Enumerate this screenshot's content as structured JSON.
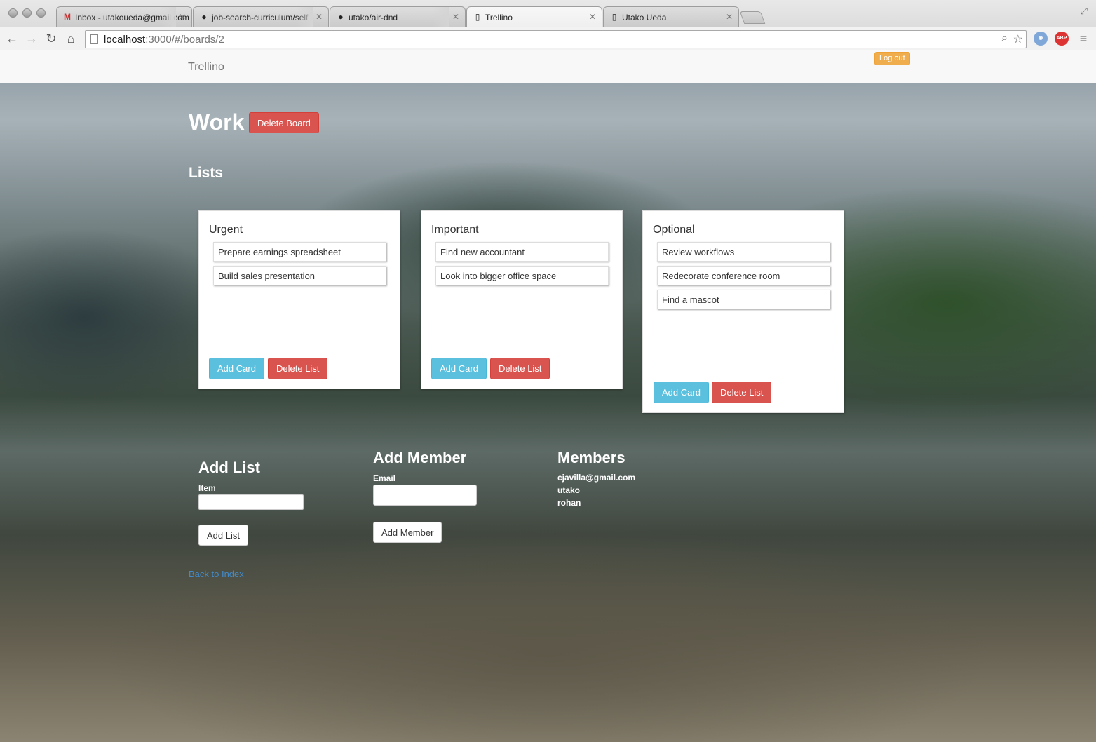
{
  "browser": {
    "tabs": [
      {
        "title": "Inbox - utakoueda@gmail.com",
        "icon": "gmail-icon"
      },
      {
        "title": "job-search-curriculum/self",
        "icon": "github-icon"
      },
      {
        "title": "utako/air-dnd",
        "icon": "github-icon"
      },
      {
        "title": "Trellino",
        "icon": "page-icon"
      },
      {
        "title": "Utako Ueda",
        "icon": "page-icon"
      }
    ],
    "url_host": "localhost",
    "url_rest": ":3000/#/boards/2"
  },
  "navbar": {
    "brand": "Trellino",
    "logout_label": "Log out"
  },
  "board": {
    "title": "Work",
    "delete_label": "Delete Board",
    "lists_heading": "Lists"
  },
  "lists": [
    {
      "title": "Urgent",
      "cards": [
        "Prepare earnings spreadsheet",
        "Build sales presentation"
      ]
    },
    {
      "title": "Important",
      "cards": [
        "Find new accountant",
        "Look into bigger office space"
      ]
    },
    {
      "title": "Optional",
      "cards": [
        "Review workflows",
        "Redecorate conference room",
        "Find a mascot"
      ]
    }
  ],
  "list_buttons": {
    "add_card": "Add Card",
    "delete_list": "Delete List"
  },
  "add_list": {
    "heading": "Add List",
    "label": "Item",
    "value": "",
    "button": "Add List"
  },
  "add_member": {
    "heading": "Add Member",
    "label": "Email",
    "value": "",
    "button": "Add Member"
  },
  "members": {
    "heading": "Members",
    "items": [
      "cjavilla@gmail.com",
      "utako",
      "rohan"
    ]
  },
  "back_link": "Back to Index"
}
